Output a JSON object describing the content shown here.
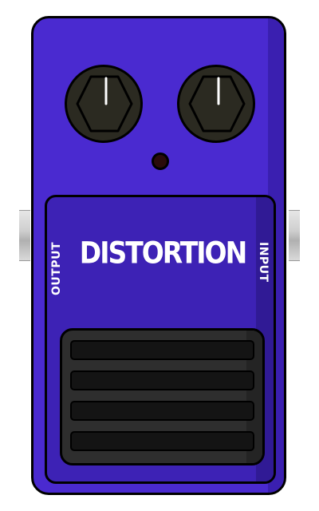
{
  "pedal": {
    "name": "DISTORTION",
    "output_label": "OUTPUT",
    "input_label": "INPUT",
    "colors": {
      "enclosure": "#4a2ad0",
      "plate": "#3d22b5",
      "knob": "#2b2a21",
      "footswitch": "#2e2e2e",
      "led_off": "#2a0b0b"
    },
    "knobs": [
      {
        "icon": "hexagon-knob-icon",
        "position": "left"
      },
      {
        "icon": "hexagon-knob-icon",
        "position": "right"
      }
    ],
    "led": {
      "state": "off"
    },
    "footswitch": {
      "grooves": 4
    }
  }
}
